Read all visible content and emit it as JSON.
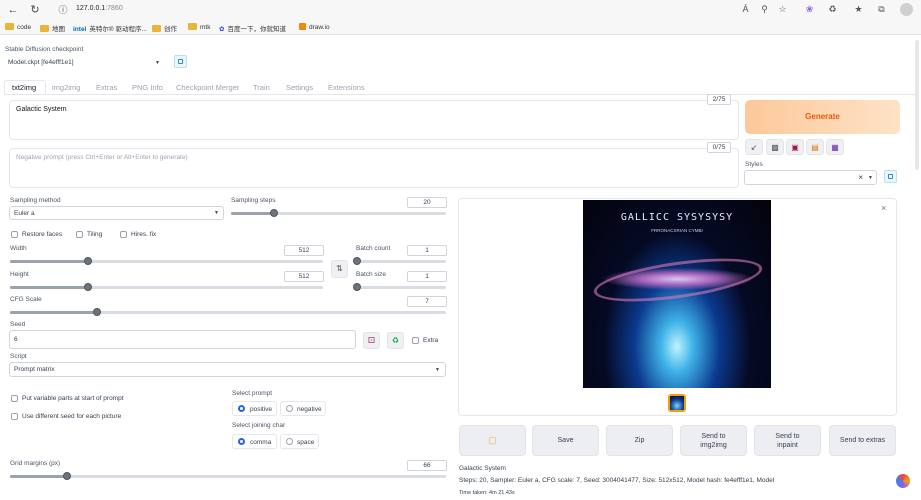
{
  "browser": {
    "url_host": "127.0.0.1",
    "url_port": ":7860",
    "bookmarks": [
      "code",
      "地图",
      "英特尔® 驱动程序...",
      "创作",
      "mtk",
      "百度一下，你就知道",
      "draw.io"
    ]
  },
  "checkpoint": {
    "label": "Stable Diffusion checkpoint",
    "value": "Model.ckpt [fe4efff1e1]"
  },
  "tabs": [
    "txt2img",
    "img2img",
    "Extras",
    "PNG Info",
    "Checkpoint Merger",
    "Train",
    "Settings",
    "Extensions"
  ],
  "active_tab": "txt2img",
  "prompt": {
    "value": "Galactic System",
    "token_count": "2/75"
  },
  "negative_prompt": {
    "placeholder": "Negative prompt (press Ctrl+Enter or Alt+Enter to generate)",
    "token_count": "0/75"
  },
  "generate_label": "Generate",
  "styles_label": "Styles",
  "sampling_method": {
    "label": "Sampling method",
    "value": "Euler a"
  },
  "sampling_steps": {
    "label": "Sampling steps",
    "value": "20"
  },
  "checkboxes": {
    "restore_faces": "Restore faces",
    "tiling": "Tiling",
    "hires_fix": "Hires. fix"
  },
  "width": {
    "label": "Width",
    "value": "512"
  },
  "height": {
    "label": "Height",
    "value": "512"
  },
  "batch_count": {
    "label": "Batch count",
    "value": "1"
  },
  "batch_size": {
    "label": "Batch size",
    "value": "1"
  },
  "cfg_scale": {
    "label": "CFG Scale",
    "value": "7"
  },
  "seed": {
    "label": "Seed",
    "value": "6",
    "extra_label": "Extra"
  },
  "script": {
    "label": "Script",
    "value": "Prompt matrix"
  },
  "prompt_matrix": {
    "put_variable_parts": "Put variable parts at start of prompt",
    "different_seed": "Use different seed for each picture",
    "select_prompt_label": "Select prompt",
    "select_prompt_options": [
      "positive",
      "negative"
    ],
    "select_joining_label": "Select joining char",
    "select_joining_options": [
      "comma",
      "space"
    ],
    "grid_margins_label": "Grid margins (px)",
    "grid_margins_value": "66"
  },
  "image": {
    "title": "GALLICC SYSYSYSY",
    "subtitle": "FRRONACXRIAN CYMBI"
  },
  "actions": [
    "Save",
    "Zip",
    "Send to img2img",
    "Send to inpaint",
    "Send to extras"
  ],
  "output": {
    "prompt": "Galactic System",
    "params": "Steps: 20, Sampler: Euler a, CFG scale: 7, Seed: 3004041477, Size: 512x512, Model hash: fe4efff1e1, Model",
    "time_taken": "Time taken: 4m 21.43s"
  },
  "colors": {
    "generate_bg": "#fcd9b4",
    "generate_text": "#ea580c",
    "accent": "#2563eb"
  },
  "sliders": {
    "sampling_steps": 0.2,
    "width": 0.25,
    "height": 0.25,
    "batch_count": 0.0,
    "batch_size": 0.0,
    "cfg_scale": 0.2,
    "grid_margins": 0.13
  }
}
